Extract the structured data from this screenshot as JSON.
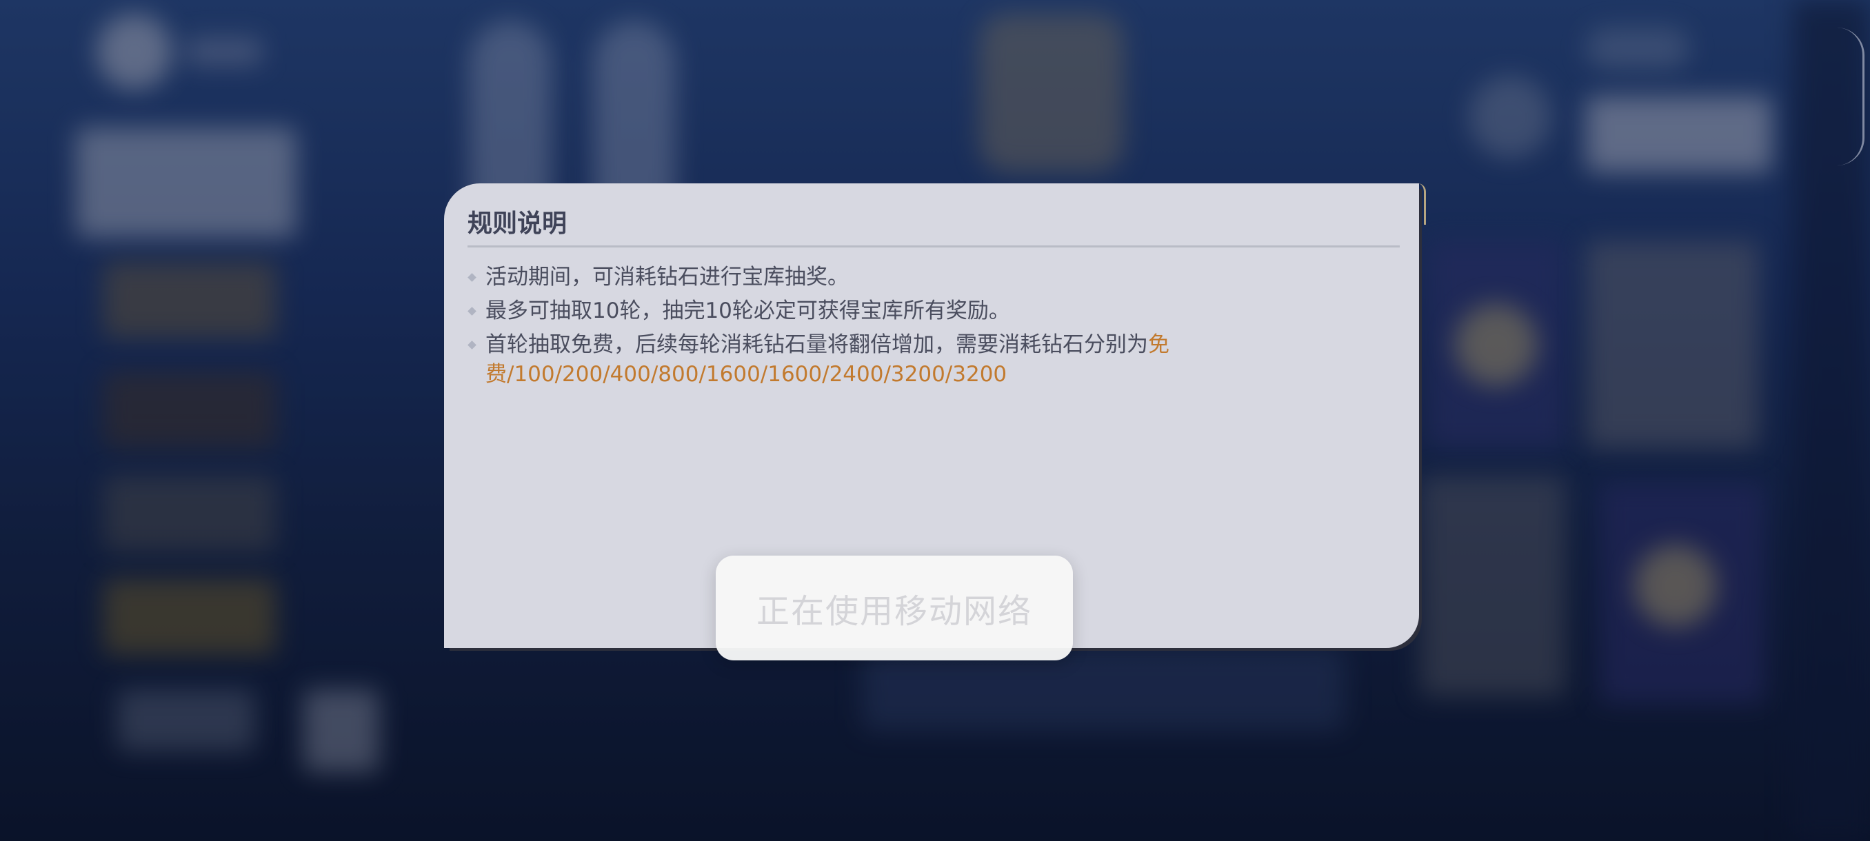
{
  "dialog": {
    "title": "规则说明",
    "rules": [
      {
        "text": "活动期间，可消耗钻石进行宝库抽奖。"
      },
      {
        "text": "最多可抽取10轮，抽完10轮必定可获得宝库所有奖励。"
      },
      {
        "text": "首轮抽取免费，后续每轮消耗钻石量将翻倍增加，需要消耗钻石分别为",
        "highlight": "免费/100/200/400/800/1600/1600/2400/3200/3200"
      }
    ]
  },
  "toast": {
    "text": "正在使用移动网络"
  },
  "colors": {
    "dialog_bg": "#d7d8e1",
    "title": "#3f4358",
    "body_text": "#4a4d5e",
    "highlight": "#c27a2e"
  }
}
